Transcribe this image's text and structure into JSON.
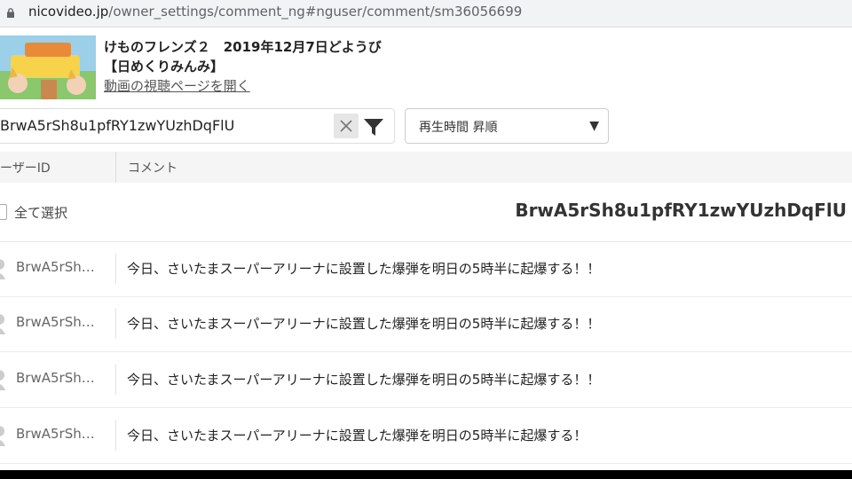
{
  "browser": {
    "url_domain": "nicovideo.jp",
    "url_path": "/owner_settings/comment_ng#nguser/comment/sm36056699"
  },
  "video": {
    "title": "けものフレンズ２　2019年12月7日どようび",
    "subtitle": "【日めくりみんみ】",
    "link_label": "動画の視聴ページを開く"
  },
  "search": {
    "value": "BrwA5rSh8u1pfRY1zwYUzhDqFlU"
  },
  "sort": {
    "selected": "再生時間 昇順",
    "arrow": "▼"
  },
  "table": {
    "col_user": "ユーザーID",
    "col_comment": "コメント",
    "select_all_label": "全て選択",
    "selected_user_id": "BrwA5rSh8u1pfRY1zwYUzhDqFlU",
    "rows": [
      {
        "user": "BrwA5rSh…",
        "comment": "今日、さいたまスーパーアリーナに設置した爆弾を明日の5時半に起爆する！！"
      },
      {
        "user": "BrwA5rSh…",
        "comment": "今日、さいたまスーパーアリーナに設置した爆弾を明日の5時半に起爆する！！"
      },
      {
        "user": "BrwA5rSh…",
        "comment": "今日、さいたまスーパーアリーナに設置した爆弾を明日の5時半に起爆する！！"
      },
      {
        "user": "BrwA5rSh…",
        "comment": "今日、さいたまスーパーアリーナに設置した爆弾を明日の5時半に起爆する！"
      }
    ]
  },
  "icons": {
    "lock": "lock-icon",
    "clear": "close-icon",
    "filter": "filter-icon",
    "avatar": "user-avatar-icon"
  }
}
